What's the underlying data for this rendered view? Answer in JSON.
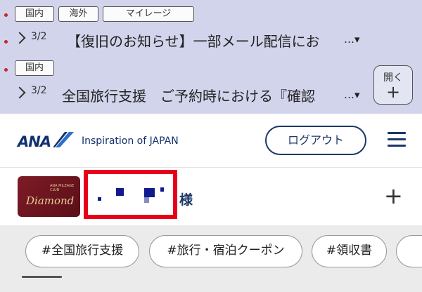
{
  "notices": [
    {
      "tags": [
        "国内",
        "海外",
        "マイレージ"
      ],
      "count": "3/2",
      "headline": "【復旧のお知らせ】一部メール配信にお",
      "more": "…▾"
    },
    {
      "tags": [
        "国内"
      ],
      "count": "3/2",
      "headline": "全国旅行支援　ご予約時における『確認",
      "more": "…▾"
    }
  ],
  "open_button": {
    "label": "開く",
    "plus": "+"
  },
  "header": {
    "logo": "ANA",
    "tagline": "Inspiration of JAPAN",
    "logout": "ログアウト",
    "menu_icon": "hamburger-icon"
  },
  "user": {
    "card": {
      "small_text": "ANA MILEAGE CLUB",
      "tier": "Diamond"
    },
    "name_redacted": true,
    "honorific": "様",
    "expand": "+"
  },
  "hashtags": [
    "#全国旅行支援",
    "#旅行・宿泊クーポン",
    "#領収書"
  ],
  "colors": {
    "notice_bg": "#d2d4ec",
    "brand_navy": "#1d3768",
    "redaction_border": "#e8001b",
    "card_bg": "#7e1b26",
    "tags_bg": "#ebebeb"
  }
}
